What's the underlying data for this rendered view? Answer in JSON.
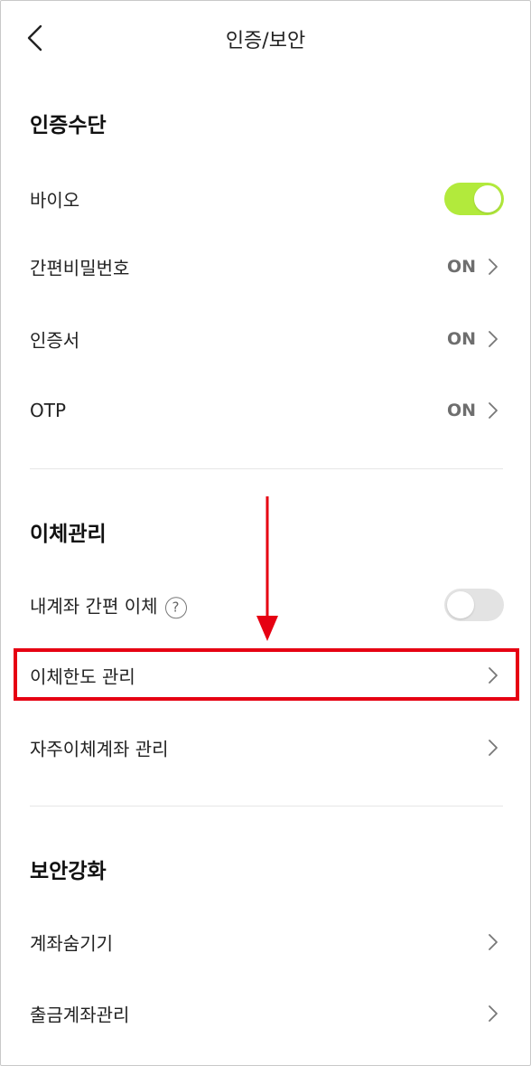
{
  "header": {
    "title": "인증/보안",
    "back_icon": "chevron-left-icon"
  },
  "sections": {
    "auth": {
      "title": "인증수단",
      "bio_label": "바이오",
      "bio_toggle": "on",
      "simple_pw_label": "간편비밀번호",
      "simple_pw_status": "ON",
      "cert_label": "인증서",
      "cert_status": "ON",
      "otp_label": "OTP",
      "otp_status": "ON"
    },
    "transfer": {
      "title": "이체관리",
      "own_account_label": "내계좌 간편 이체",
      "own_account_help": "?",
      "own_account_toggle": "off",
      "limit_label": "이체한도 관리",
      "frequent_label": "자주이체계좌 관리"
    },
    "security": {
      "title": "보안강화",
      "hide_account_label": "계좌숨기기",
      "withdraw_account_label": "출금계좌관리"
    }
  },
  "colors": {
    "toggle_on": "#b2ea3c",
    "toggle_off": "#e3e3e3",
    "highlight": "#e60012"
  }
}
